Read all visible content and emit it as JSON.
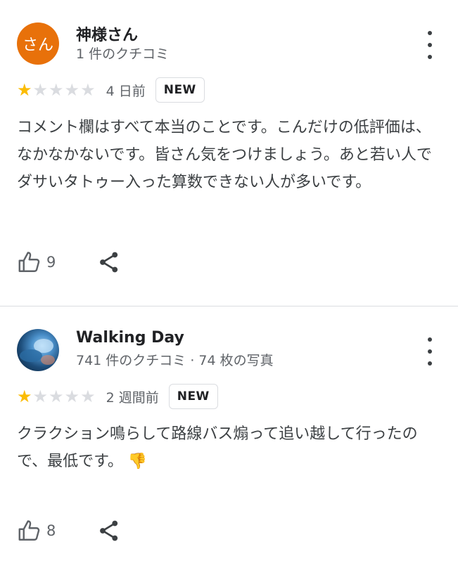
{
  "reviews": [
    {
      "author": "神様さん",
      "avatar_text": "さん",
      "avatar_color": "#e8710a",
      "meta": "1 件のクチコミ",
      "rating": 1,
      "date": "4 日前",
      "badge": "NEW",
      "text": "コメント欄はすべて本当のことです。こんだけの低評価は、なかなかないです。皆さん気をつけましょう。あと若い人でダサいタトゥー入った算数できない人が多いです。",
      "likes": "9"
    },
    {
      "author": "Walking Day",
      "meta": "741 件のクチコミ · 74 枚の写真",
      "rating": 1,
      "date": "2 週間前",
      "badge": "NEW",
      "text": "クラクション鳴らして路線バス煽って追い越して行ったので、最低です。",
      "emoji": "👎",
      "likes": "8"
    }
  ],
  "colors": {
    "star_filled": "#fbbc04",
    "star_empty": "#dadce0",
    "text_secondary": "#5f6368"
  },
  "icons": {
    "more": "more-vert-icon",
    "like": "thumb-up-icon",
    "share": "share-icon"
  }
}
